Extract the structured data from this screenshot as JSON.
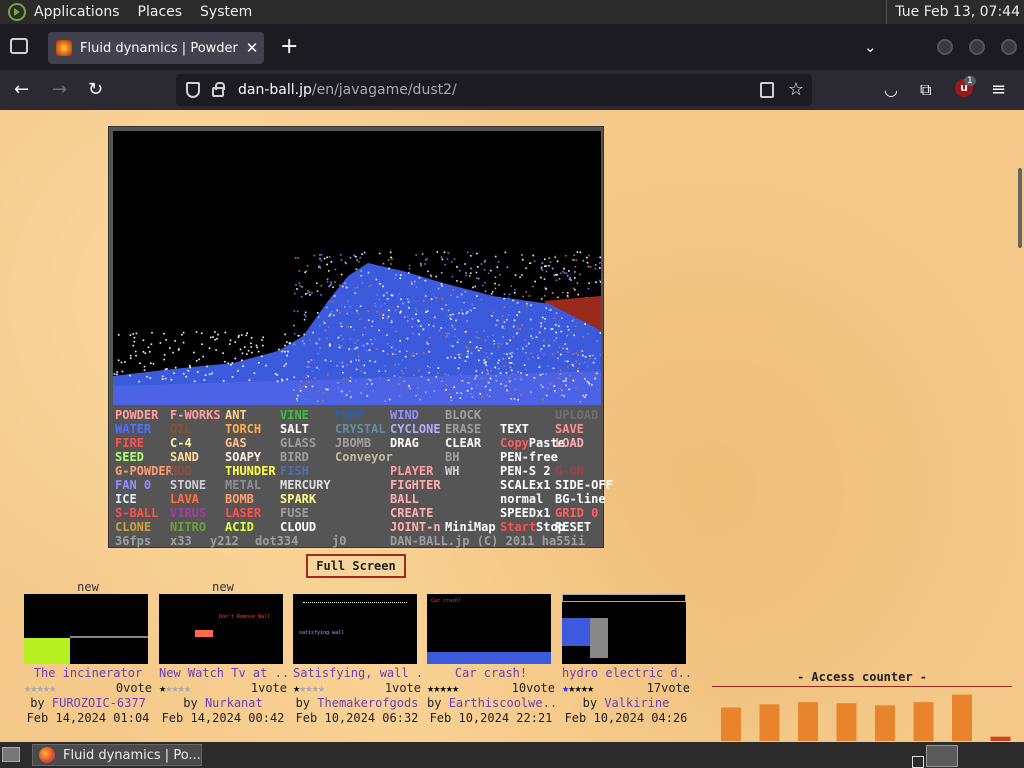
{
  "top_panel": {
    "menus": [
      "Applications",
      "Places",
      "System"
    ],
    "clock": "Tue Feb 13, 07:44"
  },
  "browser": {
    "tab_title": "Fluid dynamics | Powder Game",
    "url_domain": "dan-ball.jp",
    "url_path": "/en/javagame/dust2/",
    "extension_badge": "1"
  },
  "game": {
    "controls": [
      {
        "label": "POWDER",
        "color": "#ff9f9f"
      },
      {
        "label": "F-WORKS",
        "color": "#ff9f9f"
      },
      {
        "label": "ANT",
        "color": "#ffd08f"
      },
      {
        "label": "VINE",
        "color": "#3fbf3f"
      },
      {
        "label": "PUMP",
        "color": "#2f5f9f"
      },
      {
        "label": "WIND",
        "color": "#8f8fff"
      },
      {
        "label": "BLOCK",
        "color": "#9f9f9f"
      },
      {
        "label": "UPLOAD",
        "color": "#6f6f6f"
      },
      {
        "label": "WATER",
        "color": "#4f6fff"
      },
      {
        "label": "OIL",
        "color": "#8f4f2f"
      },
      {
        "label": "TORCH",
        "color": "#ffaf4f"
      },
      {
        "label": "SALT",
        "color": "#ffffff"
      },
      {
        "label": "CRYSTAL",
        "color": "#5f8f9f"
      },
      {
        "label": "CYCLONE",
        "color": "#afafff"
      },
      {
        "label": "ERASE",
        "color": "#9f9f9f"
      },
      {
        "label": "TEXT",
        "color": "#ffffff"
      },
      {
        "label": "SAVE",
        "color": "#ff8f8f"
      },
      {
        "label": "FIRE",
        "color": "#ff4f4f"
      },
      {
        "label": "C-4",
        "color": "#ffefaf"
      },
      {
        "label": "GAS",
        "color": "#ffbf8f"
      },
      {
        "label": "GLASS",
        "color": "#9f9f9f"
      },
      {
        "label": "JBOMB",
        "color": "#9f9f9f"
      },
      {
        "label": "DRAG",
        "color": "#ffffff"
      },
      {
        "label": "CLEAR",
        "color": "#ffffff"
      },
      {
        "label": "Copy",
        "color": "#ff5f5f"
      },
      {
        "label": "Paste",
        "color": "#ffffff"
      },
      {
        "label": "LOAD",
        "color": "#ffafaf"
      },
      {
        "label": "SEED",
        "color": "#afff6f"
      },
      {
        "label": "SAND",
        "color": "#ffdf9f"
      },
      {
        "label": "SOAPY",
        "color": "#ffefdf"
      },
      {
        "label": "BIRD",
        "color": "#9f9f9f"
      },
      {
        "label": "Conveyor",
        "color": "#bfbf9f"
      },
      {
        "label": "BH",
        "color": "#9f9f9f"
      },
      {
        "label": "PEN-free",
        "color": "#ffffff"
      },
      {
        "label": "G-POWDER",
        "color": "#ff9f6f"
      },
      {
        "label": "MUD",
        "color": "#8f4f3f"
      },
      {
        "label": "THUNDER",
        "color": "#ffff4f"
      },
      {
        "label": "FISH",
        "color": "#4f6f9f"
      },
      {
        "label": "PLAYER",
        "color": "#ff9f9f"
      },
      {
        "label": "WH",
        "color": "#cfcfcf"
      },
      {
        "label": "PEN-S 2",
        "color": "#ffffff"
      },
      {
        "label": "G-ON",
        "color": "#9f3f3f"
      },
      {
        "label": "FAN 0",
        "color": "#8f8fff"
      },
      {
        "label": "STONE",
        "color": "#cfcfcf"
      },
      {
        "label": "METAL",
        "color": "#8f8f8f"
      },
      {
        "label": "MERCURY",
        "color": "#dfdfdf"
      },
      {
        "label": "FIGHTER",
        "color": "#ffafaf"
      },
      {
        "label": "SCALEx1",
        "color": "#ffffff"
      },
      {
        "label": "SIDE-OFF",
        "color": "#ffffff"
      },
      {
        "label": "ICE",
        "color": "#dfefff"
      },
      {
        "label": "LAVA",
        "color": "#ff6f3f"
      },
      {
        "label": "BOMB",
        "color": "#ff9f6f"
      },
      {
        "label": "SPARK",
        "color": "#ffff8f"
      },
      {
        "label": "BALL",
        "color": "#ffafaf"
      },
      {
        "label": "normal",
        "color": "#ffffff"
      },
      {
        "label": "BG-line",
        "color": "#ffffff"
      },
      {
        "label": "S-BALL",
        "color": "#ff4f4f"
      },
      {
        "label": "VIRUS",
        "color": "#9f3f9f"
      },
      {
        "label": "LASER",
        "color": "#ff4f4f"
      },
      {
        "label": "FUSE",
        "color": "#9f9f9f"
      },
      {
        "label": "CREATE",
        "color": "#ffafaf"
      },
      {
        "label": "SPEEDx1",
        "color": "#ffffff"
      },
      {
        "label": "GRID 0",
        "color": "#ff5f5f"
      },
      {
        "label": "CLONE",
        "color": "#cf9f3f"
      },
      {
        "label": "NITRO",
        "color": "#6f9f3f"
      },
      {
        "label": "ACID",
        "color": "#dfff3f"
      },
      {
        "label": "CLOUD",
        "color": "#ffffff"
      },
      {
        "label": "JOINT-n",
        "color": "#ffafaf"
      },
      {
        "label": "MiniMap",
        "color": "#ffffff"
      },
      {
        "label": "Start",
        "color": "#ff4f4f"
      },
      {
        "label": "Stop",
        "color": "#ffffff"
      },
      {
        "label": "RESET",
        "color": "#ffffff"
      }
    ],
    "status": [
      "36fps",
      "x33",
      "y212",
      "dot334",
      "j0",
      "DAN-BALL.jp (C) 2011 ha55ii"
    ]
  },
  "fullscreen_label": "Full Screen",
  "thumbnails": [
    {
      "new": "new",
      "title": "The incinerator",
      "votes": "0vote",
      "stars": "★★★★★",
      "filled": 0,
      "by": "by",
      "author": "FUROZOIC-6377",
      "date": "Feb 14,2024 01:04"
    },
    {
      "new": "new",
      "title": "New Watch Tv at ...",
      "votes": "1vote",
      "stars": "★★★★★",
      "filled": 0.5,
      "by": "by",
      "author": "Nurkanat",
      "date": "Feb 14,2024 00:42"
    },
    {
      "new": "",
      "title": "Satisfying, wall ...",
      "votes": "1vote",
      "stars": "★★★★★",
      "filled": 0.5,
      "by": "by",
      "author": "Themakerofgods",
      "date": "Feb 10,2024 06:32"
    },
    {
      "new": "",
      "title": "Car crash!",
      "votes": "10vote",
      "stars": "★★★★★",
      "filled": 5,
      "by": "by",
      "author": "Earthiscoolwe...",
      "date": "Feb 10,2024 22:21"
    },
    {
      "new": "",
      "title": "hydro electric d...",
      "votes": "17vote",
      "stars": "★★★★★",
      "filled": 5,
      "by": "by",
      "author": "Valkirine",
      "date": "Feb 10,2024 04:26"
    }
  ],
  "access_counter": {
    "title": "- Access counter -",
    "bar_values": [
      0.62,
      0.68,
      0.72,
      0.7,
      0.66,
      0.72,
      0.86,
      0.08
    ]
  },
  "taskbar": {
    "window_title": "Fluid dynamics | Po..."
  }
}
